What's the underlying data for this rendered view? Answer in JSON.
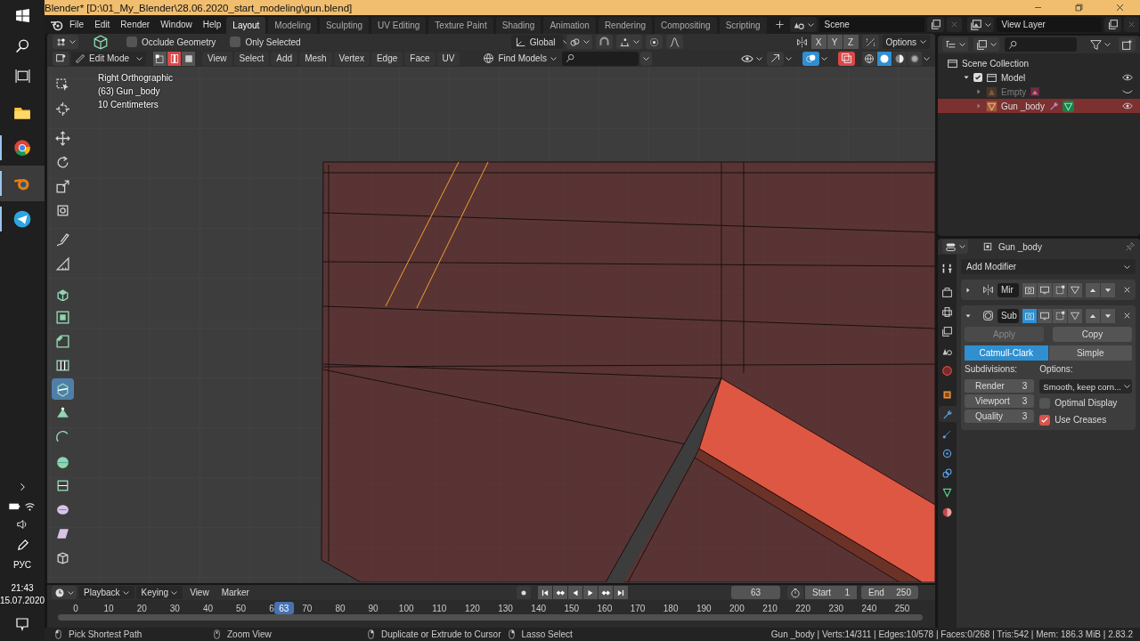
{
  "window": {
    "title": "Blender* [D:\\01_My_Blender\\28.06.2020_start_modeling\\gun.blend]"
  },
  "taskbar": {
    "apps": [
      {
        "kind": "folder",
        "selected": false,
        "running": false
      },
      {
        "kind": "browser",
        "selected": false,
        "running": true
      },
      {
        "kind": "blender",
        "selected": true,
        "running": true
      },
      {
        "kind": "messenger",
        "selected": false,
        "running": true
      }
    ],
    "language": "РУС",
    "time": "21:43",
    "date": "15.07.2020"
  },
  "menu": [
    "File",
    "Edit",
    "Render",
    "Window",
    "Help"
  ],
  "workspaces": [
    {
      "label": "Layout",
      "selected": true
    },
    {
      "label": "Modeling",
      "selected": false
    },
    {
      "label": "Sculpting",
      "selected": false
    },
    {
      "label": "UV Editing",
      "selected": false
    },
    {
      "label": "Texture Paint",
      "selected": false
    },
    {
      "label": "Shading",
      "selected": false
    },
    {
      "label": "Animation",
      "selected": false
    },
    {
      "label": "Rendering",
      "selected": false
    },
    {
      "label": "Compositing",
      "selected": false
    },
    {
      "label": "Scripting",
      "selected": false
    }
  ],
  "scene": "Scene",
  "view_layer": "View Layer",
  "tool_settings": {
    "checkboxes": [
      {
        "label": "Occlude Geometry",
        "checked": false
      },
      {
        "label": "Only Selected",
        "checked": false
      }
    ],
    "orientation": "Global",
    "axes": [
      {
        "label": "X",
        "selected": false
      },
      {
        "label": "Y",
        "selected": false
      },
      {
        "label": "Z",
        "selected": false
      }
    ],
    "options": "Options"
  },
  "viewport_header": {
    "mode": "Edit Mode",
    "select_modes": [
      {
        "kind": "vertex",
        "selected": false
      },
      {
        "kind": "edge",
        "selected": true
      },
      {
        "kind": "face",
        "selected": false
      }
    ],
    "menus": [
      "View",
      "Select",
      "Add",
      "Mesh",
      "Vertex",
      "Edge",
      "Face",
      "UV"
    ],
    "find": "Find Models",
    "overlays": true,
    "xray": true,
    "shading": [
      {
        "kind": "wireframe",
        "selected": false
      },
      {
        "kind": "solid",
        "selected": true
      },
      {
        "kind": "material",
        "selected": false
      },
      {
        "kind": "rendered",
        "selected": false
      }
    ]
  },
  "tools": [
    {
      "kind": "select",
      "selected": false
    },
    {
      "kind": "cursor",
      "selected": false
    },
    {
      "kind": "move",
      "selected": false
    },
    {
      "kind": "rotate",
      "selected": false
    },
    {
      "kind": "scale",
      "selected": false
    },
    {
      "kind": "transform",
      "selected": false
    },
    {
      "kind": "annotate",
      "selected": false
    },
    {
      "kind": "measure",
      "selected": false
    },
    {
      "kind": "extrude",
      "selected": false
    },
    {
      "kind": "inset",
      "selected": false
    },
    {
      "kind": "bevel",
      "selected": false
    },
    {
      "kind": "loopcut",
      "selected": false
    },
    {
      "kind": "knife",
      "selected": true
    },
    {
      "kind": "polybuild",
      "selected": false
    },
    {
      "kind": "spin",
      "selected": false
    },
    {
      "kind": "smooth",
      "selected": false
    },
    {
      "kind": "slide",
      "selected": false
    },
    {
      "kind": "shrink",
      "selected": false
    },
    {
      "kind": "shear",
      "selected": false
    },
    {
      "kind": "rip",
      "selected": false
    }
  ],
  "viewport_info": [
    "Right Orthographic",
    "(63) Gun _body",
    "10 Centimeters"
  ],
  "outliner": {
    "root": "Scene Collection",
    "items": [
      {
        "kind": "collection",
        "label": "Model",
        "checked": true,
        "expanded": true,
        "visible": true,
        "selected": false,
        "children": [
          {
            "kind": "empty",
            "label": "Empty",
            "visible": false,
            "selected": false
          },
          {
            "kind": "mesh",
            "label": "Gun _body",
            "visible": true,
            "selected": true
          }
        ]
      }
    ]
  },
  "properties": {
    "tabs": [
      {
        "kind": "tool",
        "selected": false
      },
      {
        "kind": "render",
        "selected": false
      },
      {
        "kind": "output",
        "selected": false
      },
      {
        "kind": "viewlayer",
        "selected": false
      },
      {
        "kind": "scene",
        "selected": false
      },
      {
        "kind": "world",
        "selected": false
      },
      {
        "kind": "object",
        "selected": false
      },
      {
        "kind": "modifier",
        "selected": true
      },
      {
        "kind": "particles",
        "selected": false
      },
      {
        "kind": "physics",
        "selected": false
      },
      {
        "kind": "constraints",
        "selected": false
      },
      {
        "kind": "data",
        "selected": false
      },
      {
        "kind": "material",
        "selected": false
      }
    ],
    "object": "Gun _body",
    "add_modifier": "Add Modifier",
    "modifiers": [
      {
        "kind": "mirror",
        "name": "Mir",
        "expanded": false,
        "edit_mode": false
      },
      {
        "kind": "subdivision",
        "name": "Sub",
        "expanded": true,
        "edit_mode": true,
        "settings": {
          "apply": {
            "label": "Apply",
            "disabled": true
          },
          "copy": "Copy",
          "algorithms": [
            {
              "label": "Catmull-Clark",
              "selected": true
            },
            {
              "label": "Simple",
              "selected": false
            }
          ],
          "subdivisions_label": "Subdivisions:",
          "levels": [
            {
              "label": "Render",
              "value": "3"
            },
            {
              "label": "Viewport",
              "value": "3"
            },
            {
              "label": "Quality",
              "value": "3"
            }
          ],
          "options_label": "Options:",
          "uv_smooth": "Smooth, keep corn...",
          "checkboxes": [
            {
              "label": "Optimal Display",
              "checked": false
            },
            {
              "label": "Use Creases",
              "checked": true
            }
          ]
        }
      }
    ]
  },
  "timeline": {
    "menus": [
      "Playback",
      "Keying",
      "View",
      "Marker"
    ],
    "frame": "63",
    "start_label": "Start",
    "start": "1",
    "end_label": "End",
    "end": "250",
    "playhead": "63",
    "ticks": [
      "0",
      "10",
      "20",
      "30",
      "40",
      "50",
      "6",
      "70",
      "80",
      "90",
      "100",
      "110",
      "120",
      "130",
      "140",
      "150",
      "160",
      "170",
      "180",
      "190",
      "200",
      "210",
      "220",
      "230",
      "240",
      "250"
    ]
  },
  "status": {
    "hints": [
      "Pick Shortest Path",
      "Zoom View",
      "Duplicate or Extrude to Cursor",
      "Lasso Select"
    ],
    "info": "Gun _body | Verts:14/311 | Edges:10/578 | Faces:0/268 | Tris:542 | Mem: 186.3 MiB | 2.83.2"
  }
}
